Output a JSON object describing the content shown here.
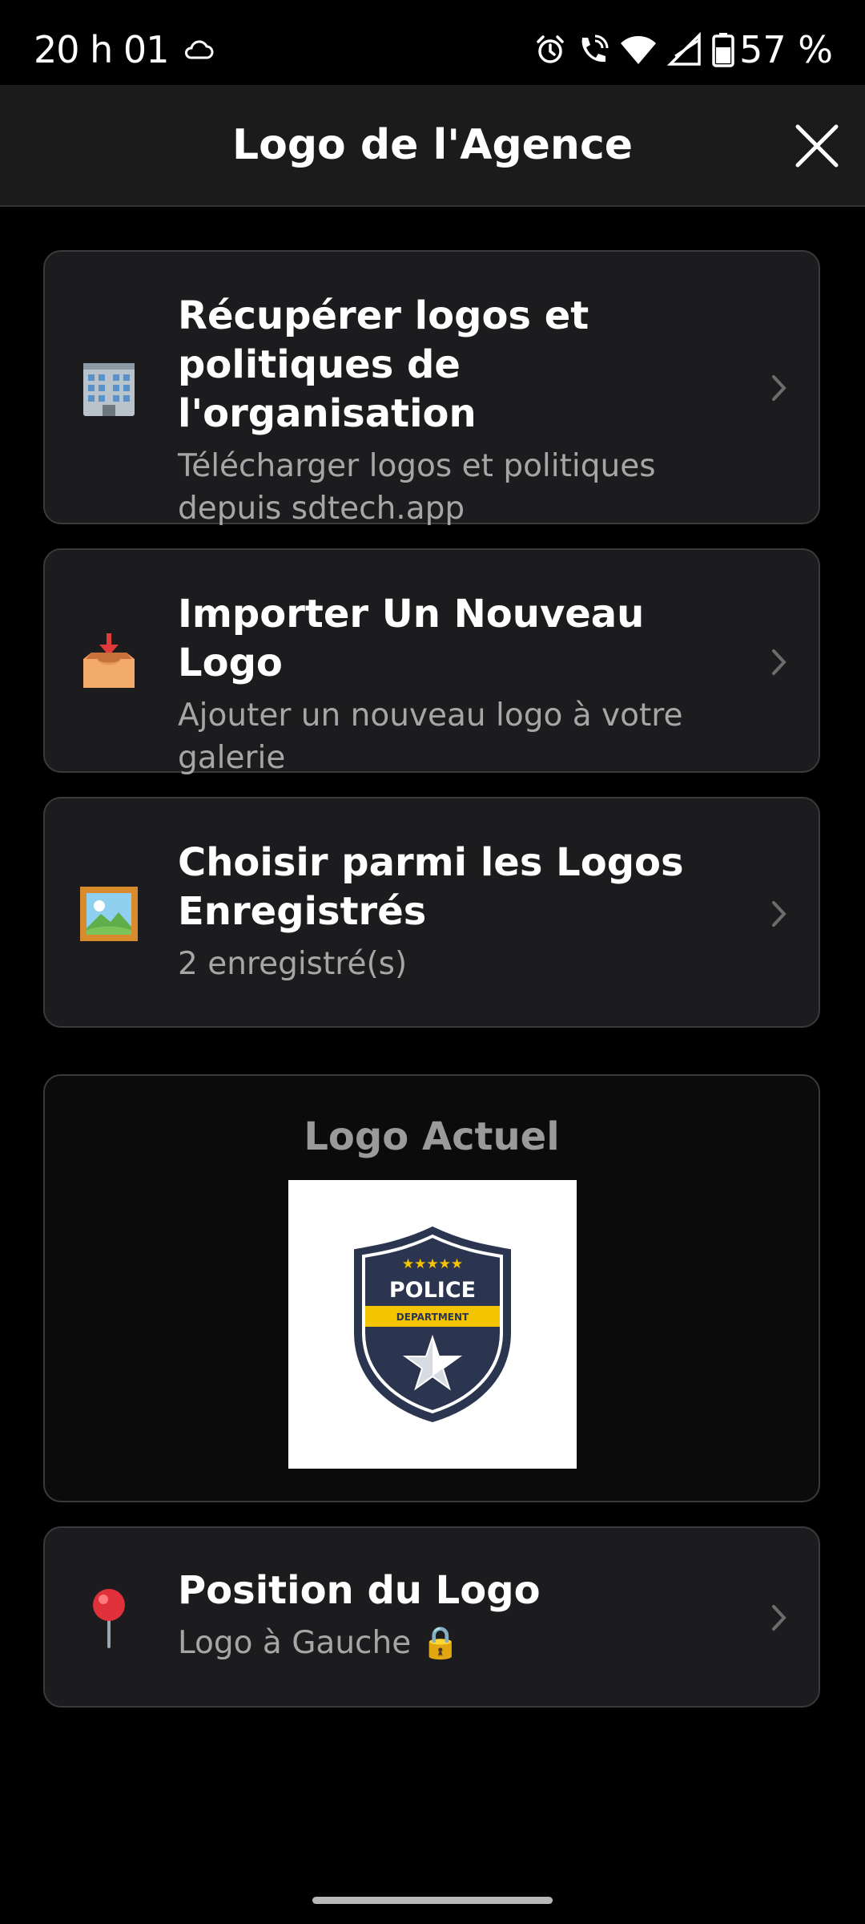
{
  "status_bar": {
    "time": "20 h 01",
    "battery": "57 %",
    "icons": [
      "cloud-icon",
      "alarm-icon",
      "wifi-call-icon",
      "wifi-icon",
      "signal-icon",
      "battery-icon"
    ]
  },
  "header": {
    "title": "Logo de l'Agence",
    "close_icon": "close-icon"
  },
  "menu": {
    "items": [
      {
        "icon": "office-building-icon",
        "title": "Récupérer logos et politiques de l'organisation",
        "subtitle": "Télécharger logos et politiques depuis sdtech.app"
      },
      {
        "icon": "inbox-tray-icon",
        "title": "Importer Un Nouveau Logo",
        "subtitle": "Ajouter un nouveau logo à votre galerie"
      },
      {
        "icon": "framed-picture-icon",
        "title": "Choisir parmi les Logos Enregistrés",
        "subtitle": "2 enregistré(s)"
      }
    ]
  },
  "current_logo": {
    "title": "Logo Actuel",
    "badge_text": "POLICE",
    "badge_band": "DEPARTMENT",
    "badge_stars": "★★★★★"
  },
  "position": {
    "icon": "pushpin-icon",
    "title": "Position du Logo",
    "subtitle": "Logo à Gauche 🔒"
  },
  "colors": {
    "background": "#000000",
    "card": "#1c1c1e",
    "badge_navy": "#2b3550",
    "badge_yellow": "#f5c400"
  }
}
